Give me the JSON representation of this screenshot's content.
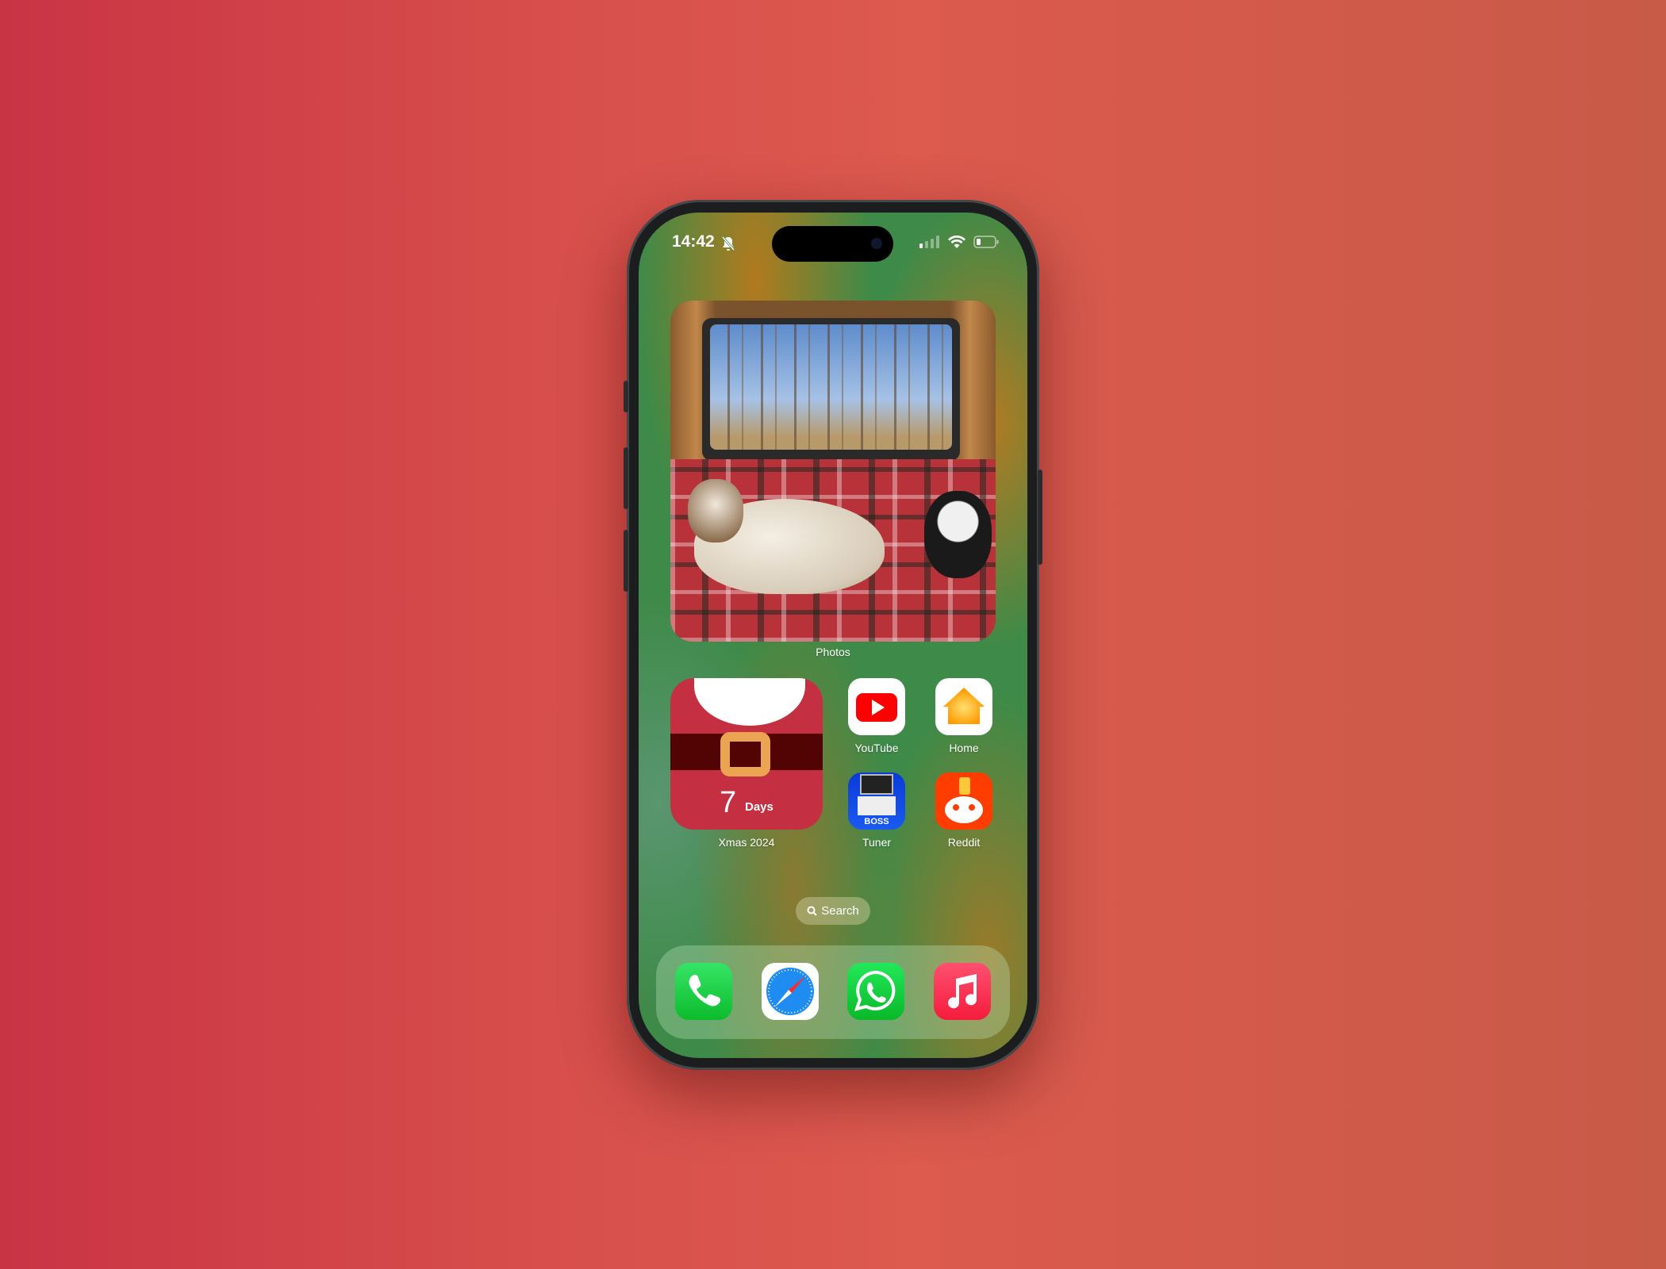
{
  "status_bar": {
    "time": "14:42",
    "silent_icon": "bell-slash-icon",
    "signal_icon": "cellular-signal-icon",
    "wifi_icon": "wifi-icon",
    "battery_icon": "battery-low-icon"
  },
  "widgets": {
    "photos": {
      "label": "Photos"
    },
    "xmas": {
      "count": "7",
      "unit": "Days",
      "label": "Xmas 2024"
    }
  },
  "apps": [
    {
      "label": "YouTube",
      "icon": "youtube-icon"
    },
    {
      "label": "Home",
      "icon": "home-icon"
    },
    {
      "label": "Tuner",
      "icon": "boss-tuner-icon"
    },
    {
      "label": "Reddit",
      "icon": "reddit-icon"
    }
  ],
  "search": {
    "label": "Search"
  },
  "dock": [
    {
      "name": "Phone",
      "icon": "phone-icon",
      "color": "#1ec94a"
    },
    {
      "name": "Safari",
      "icon": "safari-icon",
      "color": "#1e8cf0"
    },
    {
      "name": "WhatsApp",
      "icon": "whatsapp-icon",
      "color": "#22c83c"
    },
    {
      "name": "Music",
      "icon": "music-icon",
      "color": "#f5304e"
    }
  ]
}
